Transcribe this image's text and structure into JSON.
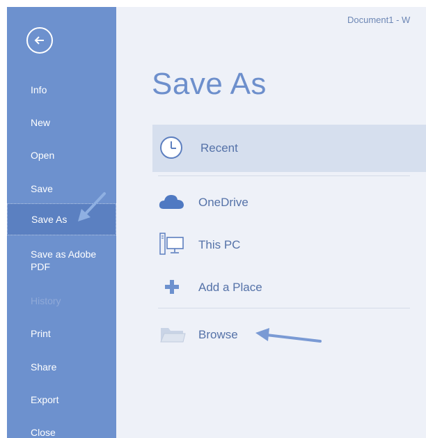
{
  "window": {
    "title": "Document1 - W"
  },
  "sidebar": {
    "back_icon": "back-arrow-icon",
    "items": [
      {
        "label": "Info"
      },
      {
        "label": "New"
      },
      {
        "label": "Open"
      },
      {
        "label": "Save"
      },
      {
        "label": "Save As",
        "active": true
      },
      {
        "label": "Save as Adobe PDF"
      },
      {
        "label": "History",
        "disabled": true
      },
      {
        "label": "Print"
      },
      {
        "label": "Share"
      },
      {
        "label": "Export"
      },
      {
        "label": "Close"
      }
    ]
  },
  "main": {
    "title": "Save As",
    "places": [
      {
        "label": "Recent",
        "icon": "clock-icon",
        "selected": true
      },
      {
        "label": "OneDrive",
        "icon": "cloud-icon"
      },
      {
        "label": "This PC",
        "icon": "computer-icon"
      },
      {
        "label": "Add a Place",
        "icon": "plus-icon"
      },
      {
        "label": "Browse",
        "icon": "folder-icon"
      }
    ]
  },
  "colors": {
    "sidebar_bg": "#6d91ce",
    "sidebar_active": "#5b80c1",
    "content_bg": "#eef1f8",
    "selected_row": "#d6dfee",
    "accent_text": "#5572a8"
  }
}
